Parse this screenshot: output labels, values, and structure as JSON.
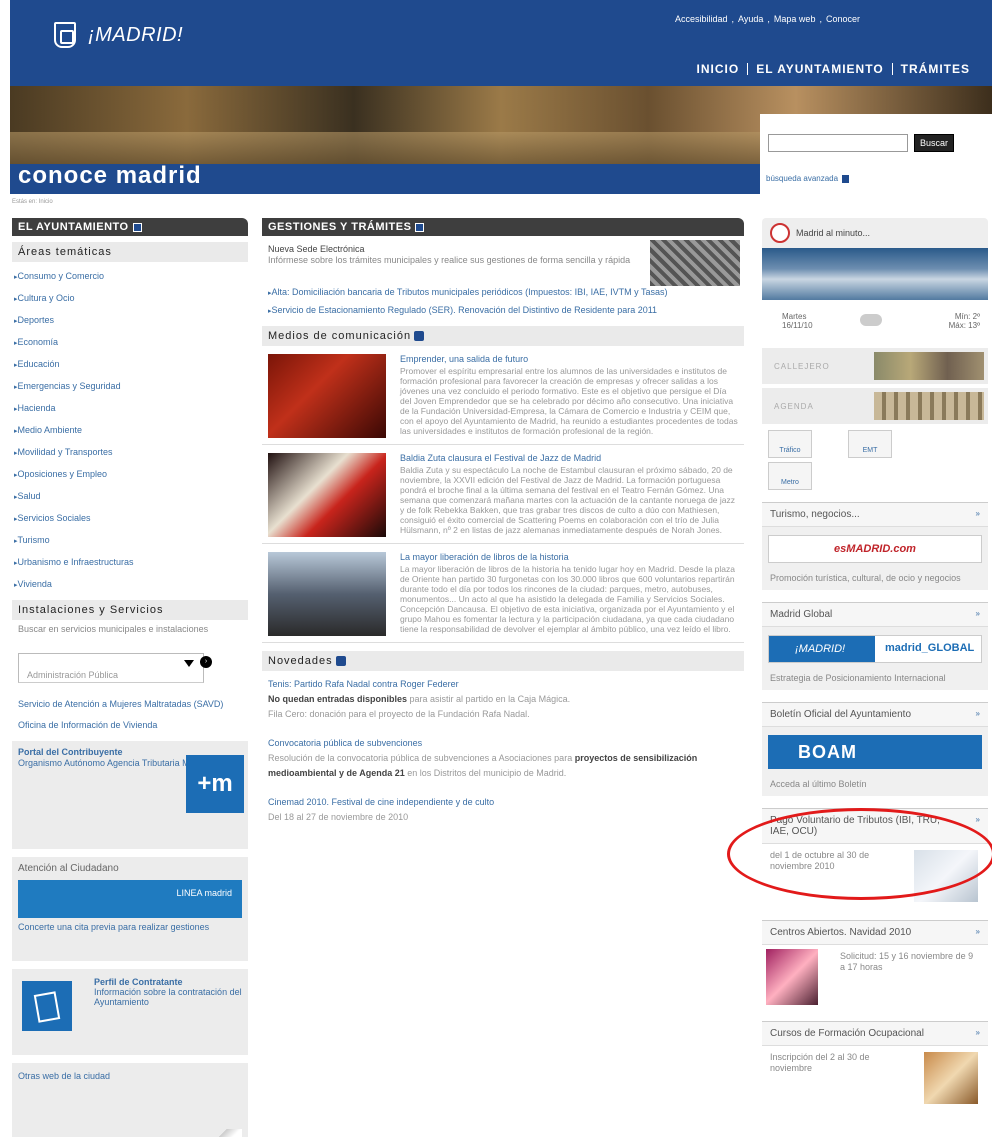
{
  "header": {
    "logo_text": "¡MADRID!",
    "top_links": [
      "Accesibilidad",
      ",",
      "Ayuda",
      ",",
      "Mapa web",
      ",",
      "Conocer"
    ],
    "main_nav": [
      "INICIO",
      "EL AYUNTAMIENTO",
      "TRÁMITES"
    ]
  },
  "banner": {
    "title": "conoce madrid"
  },
  "search": {
    "button": "Buscar",
    "advanced": "búsqueda avanzada"
  },
  "breadcrumb": "Estás en: Inicio",
  "left": {
    "ayuntamiento_title": "EL AYUNTAMIENTO",
    "areas_title": "Áreas temáticas",
    "areas": [
      "Consumo y Comercio",
      "Cultura y Ocio",
      "Deportes",
      "Economía",
      "Educación",
      "Emergencias y Seguridad",
      "Hacienda",
      "Medio Ambiente",
      "Movilidad y Transportes",
      "Oposiciones y Empleo",
      "Salud",
      "Servicios Sociales",
      "Turismo",
      "Urbanismo e Infraestructuras",
      "Vivienda"
    ],
    "instalaciones_title": "Instalaciones y Servicios",
    "instalaciones_desc": "Buscar en servicios municipales e instalaciones",
    "admin_select": "Administración Pública",
    "links": [
      "Servicio de Atención a Mujeres Maltratadas (SAVD)",
      "Oficina de Información de Vivienda"
    ],
    "contrib_title": "Portal del Contribuyente",
    "contrib_sub": "Organismo Autónomo Agencia Tributaria Madrid",
    "plusm": "+m",
    "atencion_title": "Atención al Ciudadano",
    "linea": "LINEA madrid",
    "atencion_desc": "Concerte una cita previa para realizar gestiones",
    "perfil_title": "Perfil de Contratante",
    "perfil_desc": "Información sobre la contratación del Ayuntamiento",
    "otras_webs": "Otras web de la ciudad"
  },
  "middle": {
    "gestiones_title": "GESTIONES Y TRÁMITES",
    "sede_title": "Nueva Sede Electrónica",
    "sede_desc": "Infórmese sobre los trámites municipales y realice sus gestiones de forma sencilla y rápida",
    "tramites": [
      "Alta: Domiciliación bancaria de Tributos municipales periódicos (Impuestos: IBI, IAE, IVTM y Tasas)",
      "Servicio de Estacionamiento Regulado (SER). Renovación del Distintivo de Residente para 2011"
    ],
    "medios_title": "Medios de comunicación",
    "news": [
      {
        "title": "Emprender, una salida de futuro",
        "body": "Promover el espíritu empresarial entre los alumnos de las universidades e institutos de formación profesional para favorecer la creación de empresas y ofrecer salidas a los jóvenes una vez concluido el periodo formativo. Este es el objetivo que persigue el Día del Joven Emprendedor que se ha celebrado por décimo año consecutivo. Una iniciativa de la Fundación Universidad-Empresa, la Cámara de Comercio e Industria y CEIM que, con el apoyo del Ayuntamiento de Madrid, ha reunido a estudiantes procedentes de todas las universidades e institutos de formación profesional de la región."
      },
      {
        "title": "Baldia Zuta clausura el Festival de Jazz de Madrid",
        "body": "Baldia Zuta y su espectáculo La noche de Estambul clausuran el próximo sábado, 20 de noviembre, la XXVII edición del Festival de Jazz de Madrid. La formación portuguesa pondrá el broche final a la última semana del festival en el Teatro Fernán Gómez. Una semana que comenzará mañana martes con la actuación de la cantante noruega de jazz y de folk Rebekka Bakken, que tras grabar tres discos de culto a dúo con Mathiesen, consiguió el éxito comercial de Scattering Poems en colaboración con el trío de Julia Hülsmann, nº 2 en listas de jazz alemanas inmediatamente después de Norah Jones."
      },
      {
        "title": "La mayor liberación de libros de la historia",
        "body": "La mayor liberación de libros de la historia ha tenido lugar hoy en Madrid. Desde la plaza de Oriente han partido 30 furgonetas con los 30.000 libros que 600 voluntarios repartirán durante todo el día por todos los rincones de la ciudad: parques, metro, autobuses, monumentos... Un acto al que ha asistido la delegada de Familia y Servicios Sociales. Concepción Dancausa. El objetivo de esta iniciativa, organizada por el Ayuntamiento y el grupo Mahou es fomentar la lectura y la participación ciudadana, ya que cada ciudadano tiene la responsabilidad de devolver el ejemplar al ámbito público, una vez leído el libro."
      }
    ],
    "novedades_title": "Novedades",
    "novedades": [
      {
        "title": "Tenis: Partido Rafa Nadal contra Roger Federer",
        "b1": "No quedan entradas disponibles",
        "b2": " para asistir al partido en la Caja Mágica.",
        "b3": "Fila Cero: donación para el proyecto de la Fundación Rafa Nadal."
      },
      {
        "title": "Convocatoria pública de subvenciones",
        "b1": "Resolución de la convocatoria pública de subvenciones a Asociaciones para ",
        "b2": "proyectos de sensibilización medioambiental y de Agenda 21",
        "b3": " en los Distritos del municipio de Madrid."
      },
      {
        "title": "Cinemad 2010. Festival de cine independiente y de culto",
        "b1": "Del 18 al 27 de noviembre de 2010",
        "b2": "",
        "b3": ""
      }
    ]
  },
  "right": {
    "minuto": "Madrid al minuto...",
    "weather_day": "Martes",
    "weather_date": "16/11/10",
    "weather_min": "Mín: 2º",
    "weather_max": "Máx: 13º",
    "callejero": "CALLEJERO",
    "agenda": "AGENDA",
    "trafico": "Tráfico",
    "emt": "EMT",
    "metro": "Metro",
    "turismo_title": "Turismo, negocios...",
    "esmadrid": "esMADRID.com",
    "turismo_desc": "Promoción turística, cultural, de ocio y negocios",
    "global_title": "Madrid Global",
    "global_a": "¡MADRID!",
    "global_b": "madrid_GLOBAL",
    "global_desc": "Estrategia de Posicionamiento Internacional",
    "boletin_title": "Boletín Oficial del Ayuntamiento",
    "boam": "BOAM",
    "boletin_desc": "Acceda al último Boletín",
    "pago_title": "Pago Voluntario de Tributos (IBI, TRU, IAE, OCU)",
    "pago_desc": "del 1 de octubre al 30 de noviembre 2010",
    "centros_title": "Centros Abiertos. Navidad 2010",
    "centros_desc": "Solicitud: 15 y 16 noviembre de 9 a 17 horas",
    "cursos_title": "Cursos de Formación Ocupacional",
    "cursos_desc": "Inscripción del 2 al 30 de noviembre",
    "more": "»"
  }
}
